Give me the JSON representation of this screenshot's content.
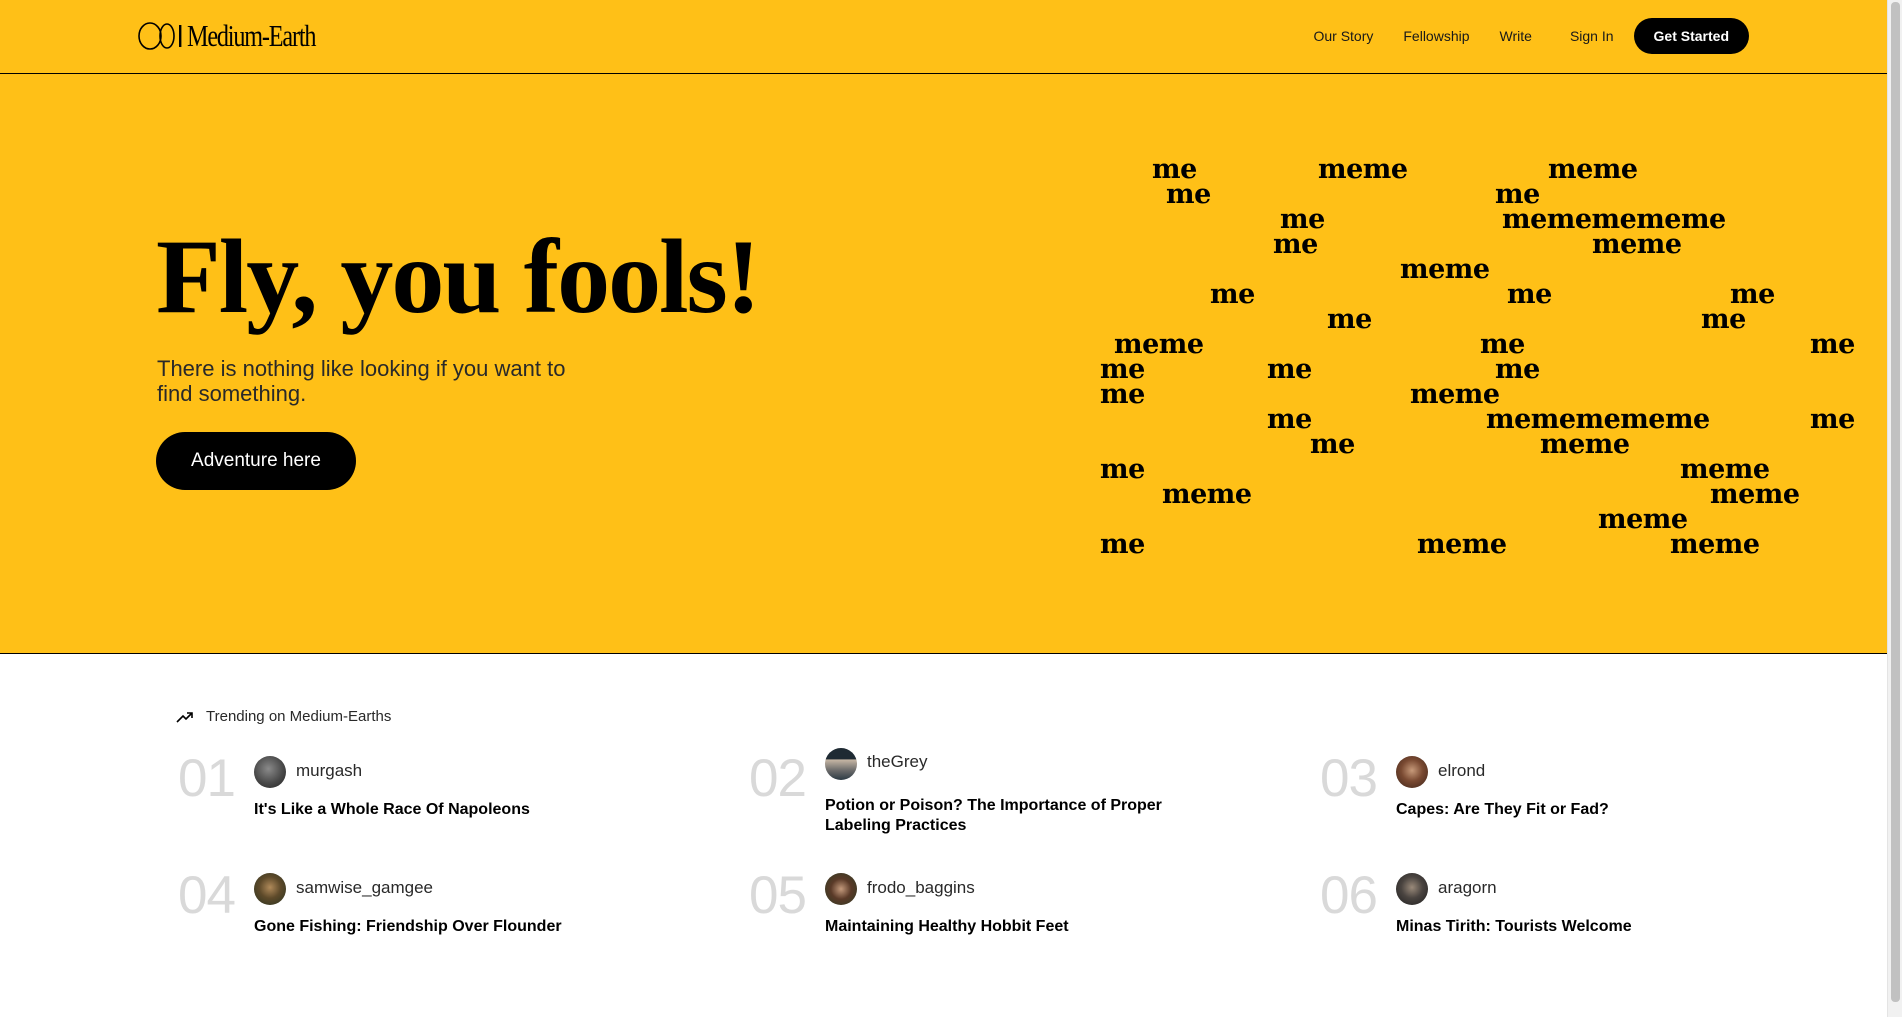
{
  "header": {
    "logo_text": "Medium-Earth",
    "nav": [
      "Our Story",
      "Fellowship",
      "Write",
      "Sign In"
    ],
    "cta": "Get Started"
  },
  "hero": {
    "title": "Fly, you fools!",
    "subtitle": "There is nothing like looking if you want to find something.",
    "button": "Adventure here",
    "pattern_words": [
      "me",
      "meme",
      "meme",
      "me",
      "me",
      "mememememe",
      "me",
      "meme",
      "meme",
      "me",
      "me",
      "me",
      "me",
      "me",
      "meme",
      "me",
      "me",
      "me",
      "me",
      "me",
      "me",
      "meme",
      "me",
      "mememememe",
      "me",
      "me",
      "meme",
      "me",
      "me",
      "meme",
      "meme",
      "meme",
      "meme",
      "me",
      "meme",
      "meme"
    ]
  },
  "trending": {
    "label": "Trending on Medium-Earths",
    "items": [
      {
        "num": "01",
        "author": "murgash",
        "title": "It's Like a Whole Race Of Napoleons"
      },
      {
        "num": "02",
        "author": "theGrey",
        "title": "Potion or Poison? The Importance of Proper Labeling Practices"
      },
      {
        "num": "03",
        "author": "elrond",
        "title": "Capes: Are They Fit or Fad?"
      },
      {
        "num": "04",
        "author": "samwise_gamgee",
        "title": "Gone Fishing: Friendship Over Flounder"
      },
      {
        "num": "05",
        "author": "frodo_baggins",
        "title": "Maintaining Healthy Hobbit Feet"
      },
      {
        "num": "06",
        "author": "aragorn",
        "title": "Minas Tirith: Tourists Welcome"
      }
    ]
  },
  "colors": {
    "brand_yellow": "#FFC017",
    "text": "#000000",
    "number_gray": "#d9d9d9"
  },
  "icons": [
    "ring-logo-icon",
    "trending-arrow-icon"
  ]
}
